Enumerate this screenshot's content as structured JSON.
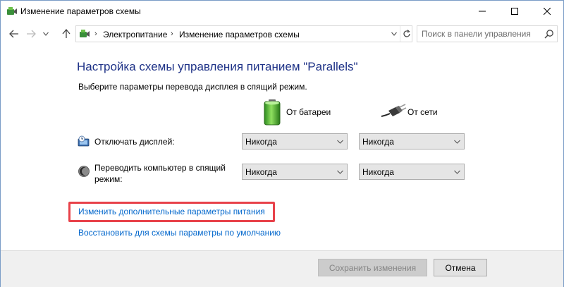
{
  "window": {
    "title": "Изменение параметров схемы",
    "controls": {
      "minimize_icon": "minimize-icon",
      "maximize_icon": "maximize-icon",
      "close_icon": "close-icon"
    }
  },
  "navigation": {
    "breadcrumbs": [
      "Электропитание",
      "Изменение параметров схемы"
    ],
    "separator": "›",
    "search_placeholder": "Поиск в панели управления"
  },
  "content": {
    "heading": "Настройка схемы управления питанием \"Parallels\"",
    "subtext": "Выберите параметры перевода дисплея в спящий режим.",
    "columns": {
      "battery": "От батареи",
      "plugged": "От сети"
    },
    "rows": [
      {
        "label": "Отключать дисплей:",
        "battery": "Никогда",
        "plugged": "Никогда",
        "icon": "display-icon"
      },
      {
        "label_line1": "Переводить компьютер в спящий",
        "label_line2": "режим:",
        "battery": "Никогда",
        "plugged": "Никогда",
        "icon": "sleep-moon-icon"
      }
    ],
    "links": {
      "advanced": "Изменить дополнительные параметры питания",
      "restore": "Восстановить для схемы параметры по умолчанию"
    }
  },
  "footer": {
    "save_label": "Сохранить изменения",
    "cancel_label": "Отмена"
  },
  "colors": {
    "heading": "#1e3287",
    "link": "#0066cc",
    "highlight": "#e8424a"
  }
}
